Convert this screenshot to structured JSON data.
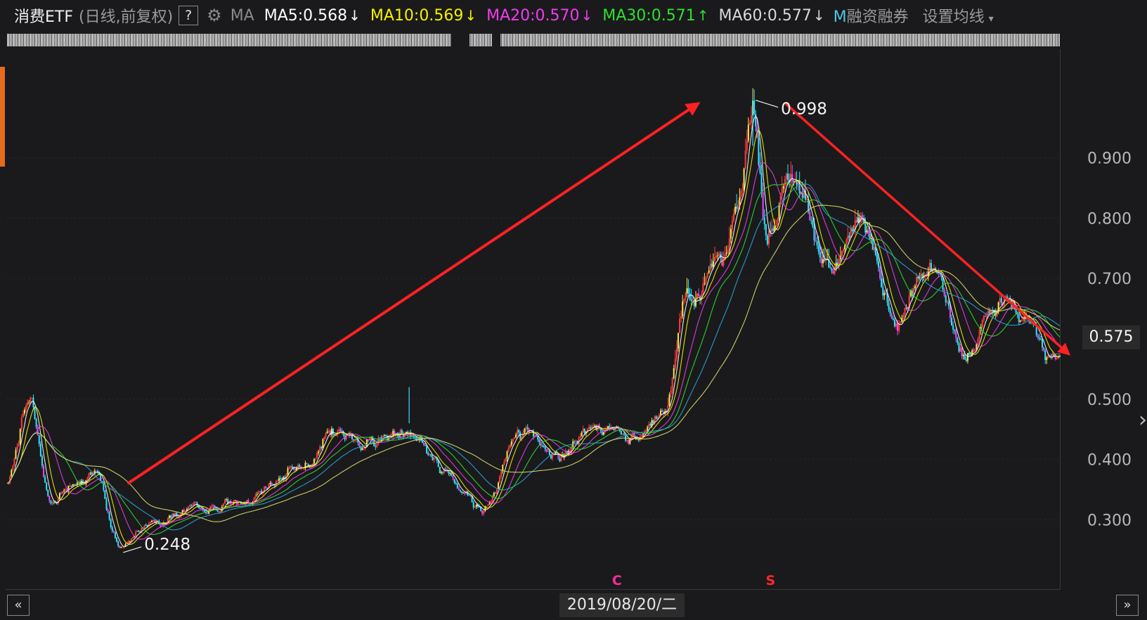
{
  "header": {
    "title": "消费ETF",
    "subtitle": "(日线,前复权)",
    "help": "?",
    "ma_label": "MA",
    "ma": [
      {
        "label": "MA5:0.568",
        "arrow": "↓",
        "color": "#ffffff"
      },
      {
        "label": "MA10:0.569",
        "arrow": "↓",
        "color": "#f5f000"
      },
      {
        "label": "MA20:0.570",
        "arrow": "↓",
        "color": "#f03cf0"
      },
      {
        "label": "MA30:0.571",
        "arrow": "↑",
        "color": "#2ee02e"
      },
      {
        "label": "MA60:0.577",
        "arrow": "↓",
        "color": "#d8d8d8"
      }
    ],
    "margin_prefix": "M",
    "margin_label": "融资融券",
    "settings": "设置均线",
    "settings_arrow": "▾"
  },
  "footer": {
    "date": "2019/08/20/二",
    "nav_left": "«",
    "nav_right": "»"
  },
  "chart_data": {
    "type": "line",
    "title": "",
    "y_ticks": [
      "0.900",
      "0.800",
      "0.700",
      "0.500",
      "0.400",
      "0.300"
    ],
    "ylim": [
      0.22,
      1.05
    ],
    "current_price": "0.575",
    "annotations": [
      {
        "text": "0.998",
        "kind": "high",
        "price": 0.998
      },
      {
        "text": "0.248",
        "kind": "low",
        "price": 0.248
      }
    ],
    "markers": [
      {
        "text": "C",
        "color": "#ff2aa0"
      },
      {
        "text": "S",
        "color": "#ff2a2a"
      }
    ],
    "key_points": [
      {
        "t": 0,
        "p": 0.36
      },
      {
        "t": 30,
        "p": 0.5
      },
      {
        "t": 60,
        "p": 0.33
      },
      {
        "t": 90,
        "p": 0.36
      },
      {
        "t": 120,
        "p": 0.375
      },
      {
        "t": 155,
        "p": 0.255
      },
      {
        "t": 200,
        "p": 0.3
      },
      {
        "t": 250,
        "p": 0.315
      },
      {
        "t": 330,
        "p": 0.33
      },
      {
        "t": 400,
        "p": 0.39
      },
      {
        "t": 445,
        "p": 0.44
      },
      {
        "t": 500,
        "p": 0.43
      },
      {
        "t": 550,
        "p": 0.45
      },
      {
        "t": 600,
        "p": 0.38
      },
      {
        "t": 650,
        "p": 0.32
      },
      {
        "t": 700,
        "p": 0.44
      },
      {
        "t": 760,
        "p": 0.41
      },
      {
        "t": 810,
        "p": 0.46
      },
      {
        "t": 860,
        "p": 0.43
      },
      {
        "t": 900,
        "p": 0.48
      },
      {
        "t": 930,
        "p": 0.68
      },
      {
        "t": 980,
        "p": 0.72
      },
      {
        "t": 1000,
        "p": 0.82
      },
      {
        "t": 1020,
        "p": 0.99
      },
      {
        "t": 1040,
        "p": 0.77
      },
      {
        "t": 1075,
        "p": 0.88
      },
      {
        "t": 1120,
        "p": 0.73
      },
      {
        "t": 1170,
        "p": 0.79
      },
      {
        "t": 1215,
        "p": 0.62
      },
      {
        "t": 1260,
        "p": 0.72
      },
      {
        "t": 1315,
        "p": 0.57
      },
      {
        "t": 1360,
        "p": 0.66
      },
      {
        "t": 1400,
        "p": 0.63
      },
      {
        "t": 1425,
        "p": 0.575
      },
      {
        "t": 1440,
        "p": 0.575
      }
    ],
    "ma_colors": {
      "ma5": "#ffffff",
      "ma10": "#f5f000",
      "ma20": "#f03cf0",
      "ma30": "#2ee02e",
      "ma60": "#dede6e",
      "ma_extra": "#2aa6d8"
    },
    "trend_arrows": [
      {
        "from": {
          "t": 165,
          "p": 0.36
        },
        "to": {
          "t": 945,
          "p": 0.99
        }
      },
      {
        "from": {
          "t": 1065,
          "p": 0.99
        },
        "to": {
          "t": 1452,
          "p": 0.575
        }
      }
    ]
  }
}
